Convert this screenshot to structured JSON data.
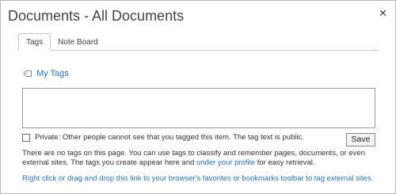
{
  "dialog": {
    "title": "Documents - All Documents",
    "close_symbol": "✕"
  },
  "tabs": [
    {
      "label": "Tags",
      "active": true
    },
    {
      "label": "Note Board",
      "active": false
    }
  ],
  "my_tags": {
    "label": "My Tags",
    "icon": "tag-icon"
  },
  "tag_input": {
    "value": ""
  },
  "private": {
    "checked": false,
    "label": "Private: Other people cannot see that you tagged this item. The tag text is public."
  },
  "save_label": "Save",
  "info": {
    "text_before": "There are no tags on this page. You can use tags to classify and remember pages, documents, or even external sites. The tags you create appear here and ",
    "profile_link": "under your profile",
    "text_after": " for easy retrieval."
  },
  "bookmark_link": "Right click or drag and drop this link to your browser's favorites or bookmarks toolbar to tag external sites.",
  "colors": {
    "link": "#1f72b8",
    "text": "#333333",
    "title": "#444444"
  }
}
